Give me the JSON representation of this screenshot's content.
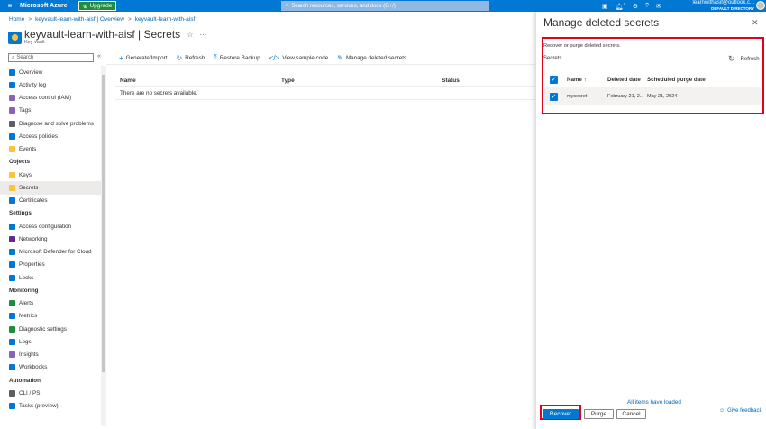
{
  "app": {
    "brand": "Microsoft Azure",
    "upgrade_label": "Upgrade",
    "search_placeholder": "Search resources, services, and docs (G+/)"
  },
  "user": {
    "email": "learnwithasif@outlook.c...",
    "directory": "DEFAULT DIRECTORY"
  },
  "notification_badge": "1",
  "breadcrumb": [
    "Home",
    "keyvault-learn-with-aisf | Overview",
    "keyvault-learn-with-aisf"
  ],
  "resource": {
    "title": "keyvault-learn-with-aisf | Secrets",
    "subtitle": "Key vault"
  },
  "sidebar": {
    "search_placeholder": "Search",
    "groups": [
      {
        "header": "",
        "items": [
          {
            "label": "Overview",
            "color": "#0078d4"
          },
          {
            "label": "Activity log",
            "color": "#0078d4"
          },
          {
            "label": "Access control (IAM)",
            "color": "#8764b8"
          },
          {
            "label": "Tags",
            "color": "#8764b8"
          },
          {
            "label": "Diagnose and solve problems",
            "color": "#605e5c"
          },
          {
            "label": "Access policies",
            "color": "#0078d4"
          },
          {
            "label": "Events",
            "color": "#fdc33d"
          }
        ]
      },
      {
        "header": "Objects",
        "items": [
          {
            "label": "Keys",
            "color": "#fdc33d"
          },
          {
            "label": "Secrets",
            "color": "#fdc33d",
            "active": true
          },
          {
            "label": "Certificates",
            "color": "#0078d4"
          }
        ]
      },
      {
        "header": "Settings",
        "items": [
          {
            "label": "Access configuration",
            "color": "#0078d4"
          },
          {
            "label": "Networking",
            "color": "#5c2d91"
          },
          {
            "label": "Microsoft Defender for Cloud",
            "color": "#0078d4"
          },
          {
            "label": "Properties",
            "color": "#0078d4"
          },
          {
            "label": "Locks",
            "color": "#0078d4"
          }
        ]
      },
      {
        "header": "Monitoring",
        "items": [
          {
            "label": "Alerts",
            "color": "#1e8d3e"
          },
          {
            "label": "Metrics",
            "color": "#0078d4"
          },
          {
            "label": "Diagnostic settings",
            "color": "#1e8d3e"
          },
          {
            "label": "Logs",
            "color": "#0078d4"
          },
          {
            "label": "Insights",
            "color": "#8764b8"
          },
          {
            "label": "Workbooks",
            "color": "#0078d4"
          }
        ]
      },
      {
        "header": "Automation",
        "items": [
          {
            "label": "CLI / PS",
            "color": "#605e5c"
          },
          {
            "label": "Tasks (preview)",
            "color": "#0078d4"
          }
        ]
      }
    ]
  },
  "toolbar": {
    "generate": "Generate/Import",
    "refresh": "Refresh",
    "restore": "Restore Backup",
    "sample": "View sample code",
    "manage": "Manage deleted secrets"
  },
  "table": {
    "col_name": "Name",
    "col_type": "Type",
    "col_status": "Status",
    "empty": "There are no secrets available."
  },
  "panel": {
    "title": "Manage deleted secrets",
    "hint": "Recover or purge deleted secrets.",
    "secrets_label": "Secrets",
    "refresh": "Refresh",
    "col_name": "Name ↑",
    "col_deleted": "Deleted date",
    "col_purge": "Scheduled purge date",
    "row": {
      "name": "mysecret",
      "deleted": "February 21, 2...",
      "purge": "May 21, 2024"
    },
    "loaded": "All items have loaded",
    "recover": "Recover",
    "purge": "Purge",
    "cancel": "Cancel",
    "feedback": "Give feedback"
  }
}
